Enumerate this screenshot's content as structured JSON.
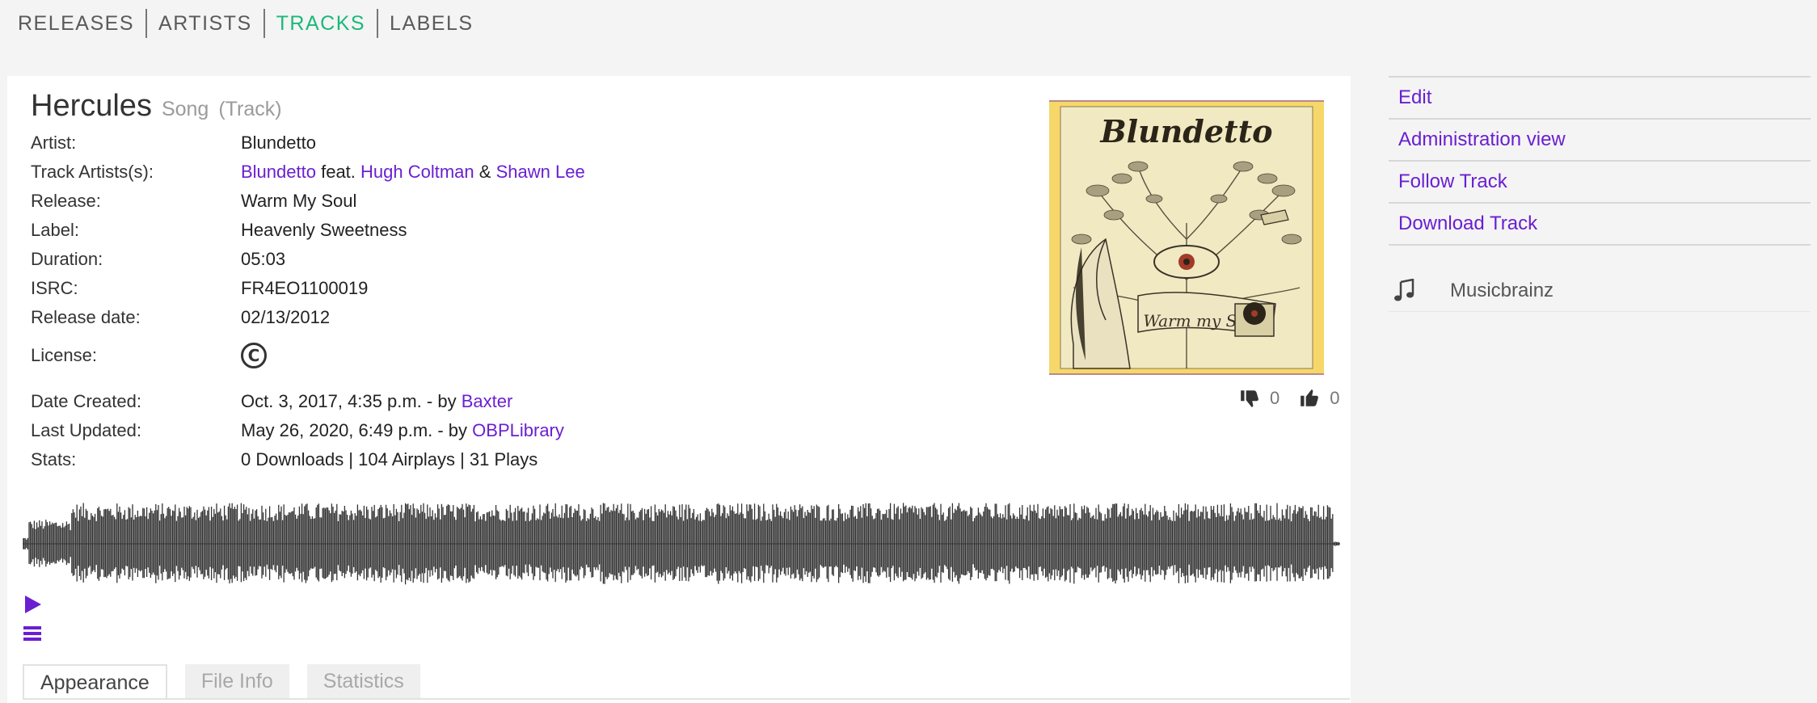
{
  "nav": {
    "items": [
      {
        "label": "RELEASES",
        "active": false
      },
      {
        "label": "ARTISTS",
        "active": false
      },
      {
        "label": "TRACKS",
        "active": true
      },
      {
        "label": "LABELS",
        "active": false
      }
    ]
  },
  "track": {
    "title": "Hercules",
    "type": "Song",
    "kind": "(Track)"
  },
  "meta": {
    "artist_label": "Artist:",
    "artist": "Blundetto",
    "track_artists_label": "Track Artists(s):",
    "track_artists": {
      "main": "Blundetto",
      "feat": "feat.",
      "feat_artist_1": "Hugh Coltman",
      "amp": "&",
      "feat_artist_2": "Shawn Lee"
    },
    "release_label": "Release:",
    "release": "Warm My Soul",
    "label_label": "Label:",
    "label": "Heavenly Sweetness",
    "duration_label": "Duration:",
    "duration": "05:03",
    "isrc_label": "ISRC:",
    "isrc": "FR4EO1100019",
    "release_date_label": "Release date:",
    "release_date": "02/13/2012",
    "license_label": "License:",
    "license_symbol": "C",
    "date_created_label": "Date Created:",
    "date_created": "Oct. 3, 2017, 4:35 p.m. - by",
    "created_by": "Baxter",
    "last_updated_label": "Last Updated:",
    "last_updated": "May 26, 2020, 6:49 p.m. - by",
    "updated_by": "OBPLibrary",
    "stats_label": "Stats:",
    "stats": "0 Downloads | 104 Airplays | 31 Plays"
  },
  "cover": {
    "artist_text": "Blundetto",
    "album_text": "Warm my Soul",
    "bg_color": "#f6d76a",
    "paper_color": "#f1e9c2"
  },
  "votes": {
    "down_count": "0",
    "up_count": "0"
  },
  "tabs": [
    {
      "label": "Appearance",
      "active": true
    },
    {
      "label": "File Info",
      "active": false
    },
    {
      "label": "Statistics",
      "active": false
    }
  ],
  "sidebar": {
    "items": [
      {
        "label": "Edit"
      },
      {
        "label": "Administration view"
      },
      {
        "label": "Follow Track"
      },
      {
        "label": "Download Track"
      }
    ],
    "musicbrainz_label": "Musicbrainz",
    "musicbrainz_icon": "music-note-icon"
  },
  "colors": {
    "link": "#6a1fd1",
    "nav_active": "#1ab97a",
    "waveform": "#333333"
  }
}
